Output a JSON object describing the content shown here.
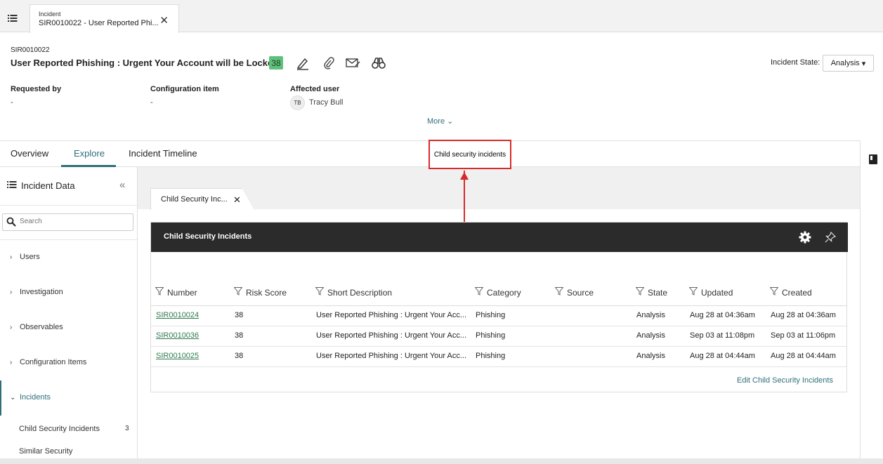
{
  "doc_tab": {
    "type": "Incident",
    "title": "SIR0010022 - User Reported Phi..."
  },
  "record": {
    "number": "SIR0010022",
    "title": "User Reported Phishing : Urgent Your Account will be Locked",
    "risk_score": "38",
    "state_label": "Incident State:",
    "state_value": "Analysis"
  },
  "fields": {
    "requested_by": {
      "label": "Requested by",
      "value": "-"
    },
    "config_item": {
      "label": "Configuration item",
      "value": "-"
    },
    "affected_user": {
      "label": "Affected user",
      "initials": "TB",
      "value": "Tracy Bull"
    }
  },
  "more_label": "More",
  "tabs": [
    {
      "label": "Overview"
    },
    {
      "label": "Explore"
    },
    {
      "label": "Incident Timeline"
    }
  ],
  "annotation": "Child security incidents",
  "sidebar": {
    "title": "Incident Data",
    "search_placeholder": "Search",
    "items": [
      {
        "label": "Users"
      },
      {
        "label": "Investigation"
      },
      {
        "label": "Observables"
      },
      {
        "label": "Configuration Items"
      },
      {
        "label": "Incidents"
      }
    ],
    "sub_items": [
      {
        "label": "Child Security Incidents",
        "count": "3"
      },
      {
        "label": "Similar Security"
      }
    ]
  },
  "card_tab": {
    "label": "Child Security Inc..."
  },
  "panel": {
    "title": "Child Security Incidents",
    "columns": [
      "Number",
      "Risk Score",
      "Short Description",
      "Category",
      "Source",
      "State",
      "Updated",
      "Created"
    ],
    "rows": [
      {
        "number": "SIR0010024",
        "risk": "38",
        "desc": "User Reported Phishing : Urgent Your Acc...",
        "category": "Phishing",
        "source": "",
        "state": "Analysis",
        "updated": "Aug 28 at 04:36am",
        "created": "Aug 28 at 04:36am"
      },
      {
        "number": "SIR0010036",
        "risk": "38",
        "desc": "User Reported Phishing : Urgent Your Acc...",
        "category": "Phishing",
        "source": "",
        "state": "Analysis",
        "updated": "Sep 03 at 11:08pm",
        "created": "Sep 03 at 11:06pm"
      },
      {
        "number": "SIR0010025",
        "risk": "38",
        "desc": "User Reported Phishing : Urgent Your Acc...",
        "category": "Phishing",
        "source": "",
        "state": "Analysis",
        "updated": "Aug 28 at 04:44am",
        "created": "Aug 28 at 04:44am"
      }
    ],
    "edit_link": "Edit Child Security Incidents"
  },
  "colors": {
    "accent": "#2f6f7a",
    "score_badge": "#5ec17a",
    "annotation": "#d9292b",
    "panel_header": "#2b2b2b"
  }
}
